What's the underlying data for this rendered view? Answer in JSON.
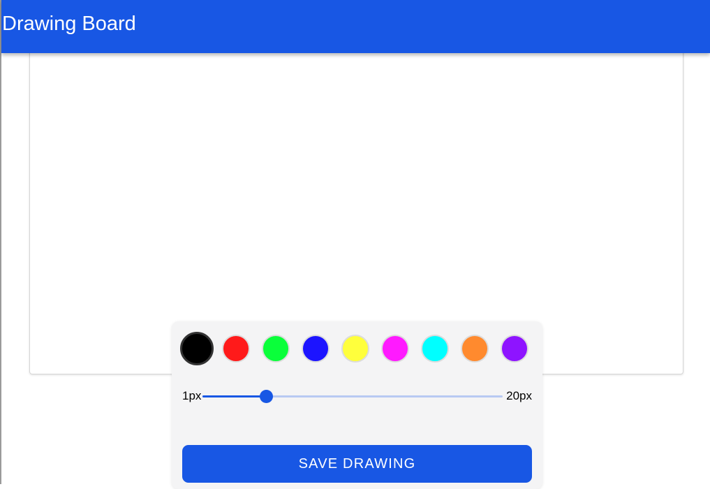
{
  "app_bar": {
    "title": "Drawing Board",
    "background_color": "#1857e4"
  },
  "palette": {
    "selected_index": 0,
    "colors": [
      {
        "name": "black",
        "hex": "#000000"
      },
      {
        "name": "red",
        "hex": "#ff1a1a"
      },
      {
        "name": "green",
        "hex": "#0aff3a"
      },
      {
        "name": "blue",
        "hex": "#1c14ff"
      },
      {
        "name": "yellow",
        "hex": "#ffff3c"
      },
      {
        "name": "magenta",
        "hex": "#ff1aff"
      },
      {
        "name": "cyan",
        "hex": "#00ffff"
      },
      {
        "name": "orange",
        "hex": "#ff8a2e"
      },
      {
        "name": "purple",
        "hex": "#8e14ff"
      }
    ]
  },
  "brush_size": {
    "min_label": "1px",
    "max_label": "20px",
    "min": 1,
    "max": 20,
    "value": 5
  },
  "actions": {
    "save_label": "SAVE DRAWING"
  }
}
